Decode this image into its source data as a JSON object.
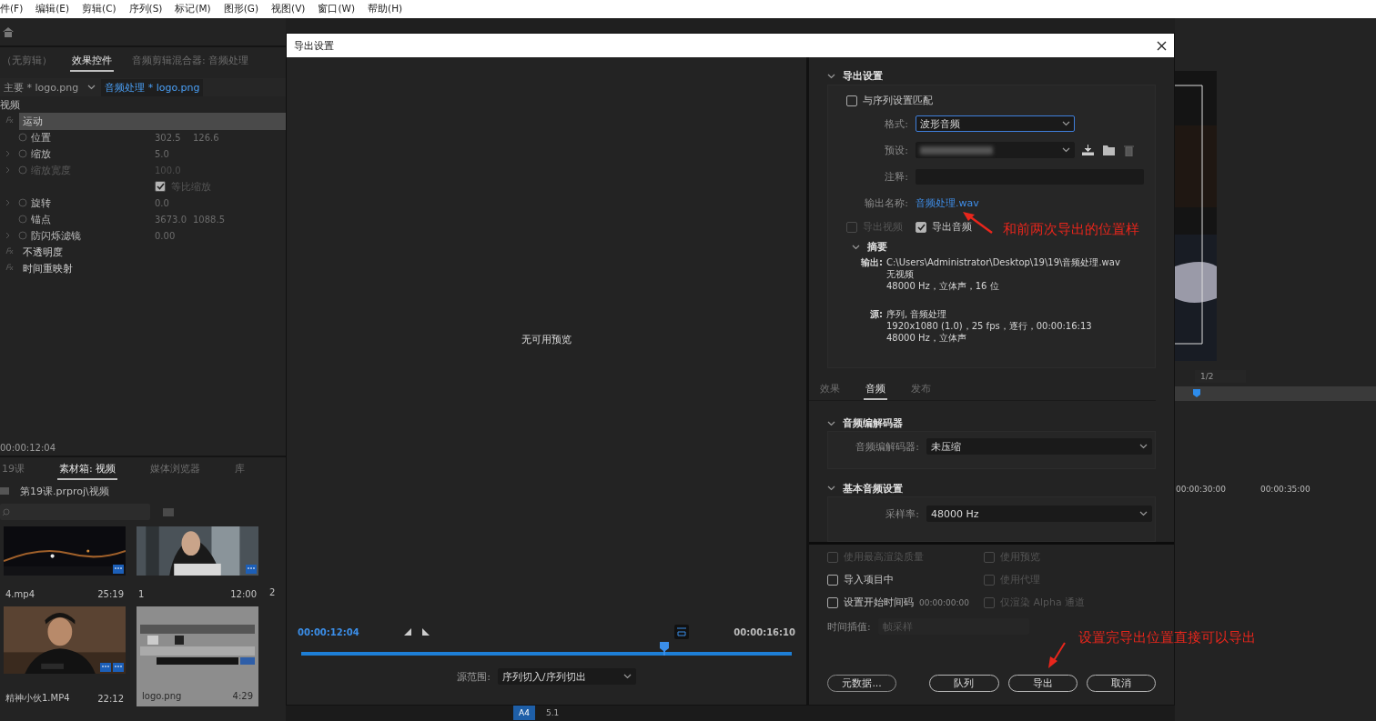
{
  "menu": [
    "件(F)",
    "编辑(E)",
    "剪辑(C)",
    "序列(S)",
    "标记(M)",
    "图形(G)",
    "视图(V)",
    "窗口(W)",
    "帮助(H)"
  ],
  "left_panel": {
    "tabs": [
      {
        "label": "（无剪辑）",
        "selected": false
      },
      {
        "label": "效果控件",
        "selected": true
      },
      {
        "label": "音频剪辑混合器: 音频处理",
        "selected": false
      }
    ],
    "clip_master": "主要 * logo.png",
    "clip_sequence": "音频处理 * logo.png",
    "section": "视频",
    "properties": [
      {
        "kind": "effect",
        "name": "运动",
        "selected": true
      },
      {
        "kind": "param",
        "name": "位置",
        "values": [
          "302.5",
          "126.6"
        ],
        "expandable": false,
        "disabled": false
      },
      {
        "kind": "param",
        "name": "缩放",
        "values": [
          "5.0"
        ],
        "expandable": true,
        "disabled": false
      },
      {
        "kind": "param",
        "name": "缩放宽度",
        "values": [
          "100.0"
        ],
        "expandable": true,
        "disabled": true
      },
      {
        "kind": "checkbox",
        "name": "等比缩放",
        "checked": true,
        "disabled": true
      },
      {
        "kind": "param",
        "name": "旋转",
        "values": [
          "0.0"
        ],
        "expandable": true,
        "disabled": false
      },
      {
        "kind": "param",
        "name": "锚点",
        "values": [
          "3673.0",
          "1088.5"
        ],
        "expandable": false,
        "disabled": false
      },
      {
        "kind": "param",
        "name": "防闪烁滤镜",
        "values": [
          "0.00"
        ],
        "expandable": true,
        "disabled": false
      },
      {
        "kind": "effect",
        "name": "不透明度",
        "selected": false
      },
      {
        "kind": "effect",
        "name": "时间重映射",
        "selected": false
      }
    ],
    "timecode": "00:00:12:04"
  },
  "project": {
    "tabs": [
      {
        "label": "19课",
        "selected": false
      },
      {
        "label": "素材箱: 视频",
        "selected": true
      },
      {
        "label": "媒体浏览器",
        "selected": false
      },
      {
        "label": "库",
        "selected": false
      }
    ],
    "path": "第19课.prproj\\视频",
    "items": [
      {
        "name": "4.mp4",
        "duration": "25:19",
        "kind": "video",
        "selected": false
      },
      {
        "name": "1",
        "duration": "12:00",
        "kind": "video",
        "selected": false
      },
      {
        "name": "精神小伙1.MP4",
        "duration": "22:12",
        "kind": "av",
        "selected": false
      },
      {
        "name": "logo.png",
        "duration": "4:29",
        "selected": true
      }
    ],
    "partial_item": "2"
  },
  "dialog": {
    "title": "导出设置",
    "preview": {
      "message": "无可用预览",
      "in_time": "00:00:12:04",
      "out_time": "00:00:16:10",
      "level": 0.74,
      "source_range_label": "源范围:",
      "source_range": "序列切入/序列切出"
    },
    "export_settings": {
      "title": "导出设置",
      "expanded": true,
      "match_sequence": {
        "label": "与序列设置匹配",
        "checked": false
      },
      "format": {
        "label": "格式:",
        "value": "波形音频",
        "focused": true
      },
      "preset": {
        "label": "预设:",
        "focused": false
      },
      "comments": {
        "label": "注释:"
      },
      "output_name": {
        "label": "输出名称:",
        "value": "音频处理.wav"
      },
      "export_video": {
        "label": "导出视频",
        "checked": false,
        "disabled": true
      },
      "export_audio": {
        "label": "导出音频",
        "checked": true,
        "disabled": false
      },
      "summary": {
        "title": "摘要",
        "expanded": true,
        "output_label": "输出:",
        "output_lines": [
          "C:\\Users\\Administrator\\Desktop\\19\\19\\音频处理.wav",
          "无视频",
          "48000 Hz，立体声，16 位"
        ],
        "source_label": "源:",
        "source_lines": [
          "序列, 音频处理",
          "1920x1080 (1.0)，25 fps，逐行，00:00:16:13",
          "48000 Hz，立体声"
        ]
      }
    },
    "settings_tabs": [
      {
        "label": "效果",
        "selected": false
      },
      {
        "label": "音频",
        "selected": true
      },
      {
        "label": "发布",
        "selected": false
      }
    ],
    "codec_section": {
      "title": "音频编解码器",
      "expanded": true,
      "label": "音频编解码器:",
      "value": "未压缩"
    },
    "basic_audio": {
      "title": "基本音频设置",
      "expanded": true,
      "label": "采样率:",
      "value": "48000 Hz"
    },
    "options": [
      {
        "label": "使用最高渲染质量",
        "checked": false,
        "disabled": true
      },
      {
        "label": "使用预览",
        "checked": false,
        "disabled": true
      },
      {
        "label": "导入项目中",
        "checked": false,
        "disabled": false
      },
      {
        "label": "使用代理",
        "checked": false,
        "disabled": true
      },
      {
        "label": "设置开始时间码",
        "value": "00:00:00:00",
        "checked": false,
        "disabled": false
      },
      {
        "label": "仅渲染 Alpha 通道",
        "checked": false,
        "disabled": true
      }
    ],
    "time_interpolation": {
      "label": "时间插值:",
      "value": "帧采样",
      "disabled": true
    },
    "buttons": [
      {
        "label": "元数据...",
        "kind": "secondary"
      },
      {
        "label": "队列",
        "kind": "primary"
      },
      {
        "label": "导出",
        "kind": "primary"
      },
      {
        "label": "取消",
        "kind": "primary"
      }
    ]
  },
  "annotations": [
    {
      "text": "和前两次导出的位置样"
    },
    {
      "text": "设置完导出位置直接可以导出"
    }
  ],
  "right_strip": {
    "zoom": "1/2",
    "ruler": [
      "00:00:30:00",
      "00:00:35:00"
    ]
  },
  "bottom_strip": {
    "track": "A4",
    "channel": "5.1"
  }
}
